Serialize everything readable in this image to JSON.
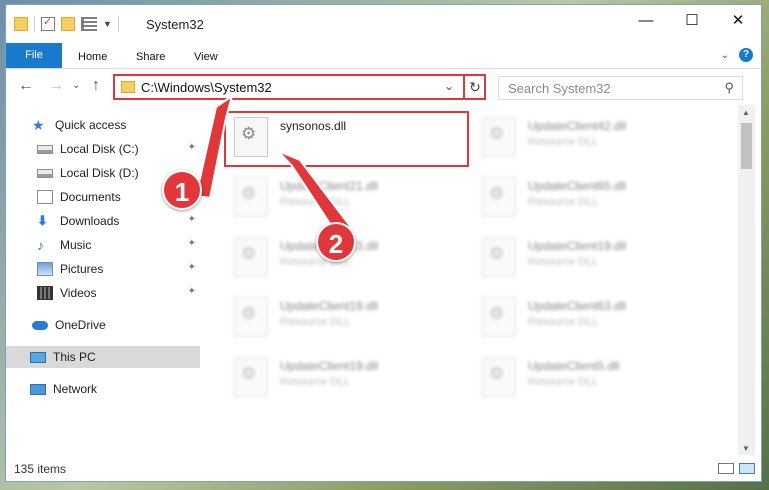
{
  "window": {
    "title": "System32",
    "minimize": "—",
    "maximize": "☐",
    "close": "✕"
  },
  "ribbon": {
    "tabs": [
      "File",
      "Home",
      "Share",
      "View"
    ],
    "collapse": "⌄",
    "help": "?"
  },
  "nav": {
    "back": "←",
    "forward": "→",
    "recent": "⌄",
    "up": "↑",
    "address": "C:\\Windows\\System32",
    "address_dropdown": "⌄",
    "refresh": "↻",
    "search_placeholder": "Search System32",
    "search_icon": "⚲"
  },
  "sidebar": {
    "items": [
      {
        "label": "Quick access",
        "icon": "star-icon"
      },
      {
        "label": "Local Disk (C:)",
        "icon": "drive-icon",
        "pinned": true
      },
      {
        "label": "Local Disk (D:)",
        "icon": "drive-icon"
      },
      {
        "label": "Documents",
        "icon": "documents-icon",
        "pinned": true
      },
      {
        "label": "Downloads",
        "icon": "downloads-icon",
        "pinned": true
      },
      {
        "label": "Music",
        "icon": "music-icon",
        "pinned": true
      },
      {
        "label": "Pictures",
        "icon": "pictures-icon",
        "pinned": true
      },
      {
        "label": "Videos",
        "icon": "videos-icon",
        "pinned": true
      },
      {
        "label": "OneDrive",
        "icon": "cloud-icon"
      },
      {
        "label": "This PC",
        "icon": "computer-icon",
        "selected": true
      },
      {
        "label": "Network",
        "icon": "network-icon"
      }
    ],
    "pin_glyph": "📌"
  },
  "files": [
    {
      "name": "synsonos.dll",
      "type": "",
      "highlighted": true
    },
    {
      "name": "UpdateClient42.dll",
      "type": "Resource DLL"
    },
    {
      "name": "UpdateClient21.dll",
      "type": "Resource DLL"
    },
    {
      "name": "UpdateClient65.dll",
      "type": "Resource DLL"
    },
    {
      "name": "UpdateClient53.dll",
      "type": "Resource DLL"
    },
    {
      "name": "UpdateClient19.dll",
      "type": "Resource DLL"
    },
    {
      "name": "UpdateClient19.dll",
      "type": "Resource DLL"
    },
    {
      "name": "UpdateClient63.dll",
      "type": "Resource DLL"
    },
    {
      "name": "UpdateClient19.dll",
      "type": "Resource DLL"
    },
    {
      "name": "UpdateClient5.dll",
      "type": "Resource DLL"
    }
  ],
  "status": {
    "item_count": "135 items"
  },
  "annotations": {
    "step1": "1",
    "step2": "2",
    "color": "#e0373a"
  }
}
